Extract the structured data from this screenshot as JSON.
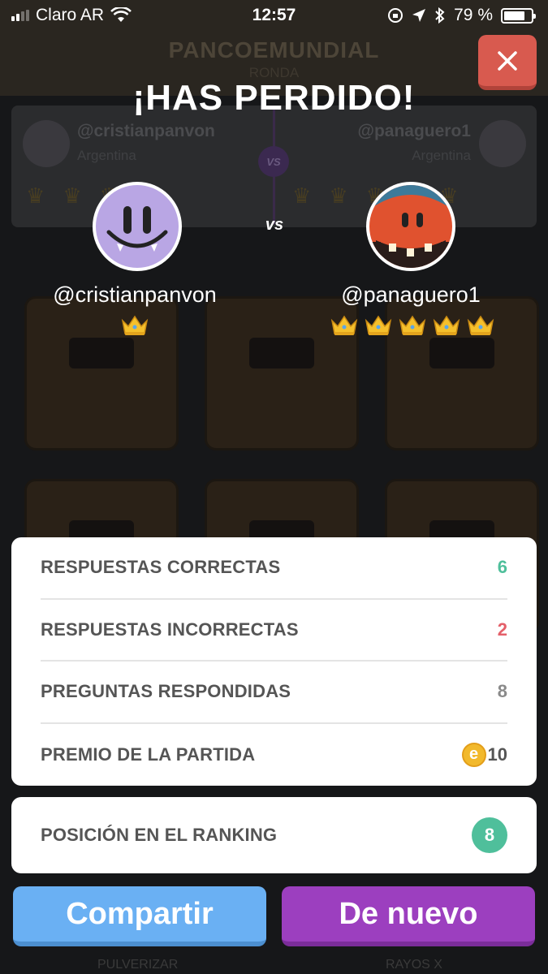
{
  "status_bar": {
    "carrier": "Claro AR",
    "time": "12:57",
    "battery": "79 %"
  },
  "background": {
    "game_title": "PANCOEMUNDIAL",
    "round_label": "RONDA",
    "left_name": "@cristianpanvon",
    "left_country": "Argentina",
    "vs": "VS",
    "right_name": "@panaguero1",
    "right_country": "Argentina",
    "bottom_left": "PULVERIZAR",
    "bottom_right": "RAYOS X"
  },
  "result": {
    "title": "¡HAS PERDIDO!"
  },
  "player_left": {
    "username": "@cristianpanvon",
    "crowns": 1
  },
  "vs_label": "vs",
  "player_right": {
    "username": "@panaguero1",
    "crowns": 5
  },
  "stats": {
    "correct": {
      "label": "RESPUESTAS CORRECTAS",
      "value": "6",
      "color": "#4fbf9b"
    },
    "incorrect": {
      "label": "RESPUESTAS INCORRECTAS",
      "value": "2",
      "color": "#e4606a"
    },
    "answered": {
      "label": "PREGUNTAS RESPONDIDAS",
      "value": "8",
      "color": "#8a8a8a"
    },
    "prize": {
      "label": "PREMIO DE LA PARTIDA",
      "coin_symbol": "e",
      "value": "10",
      "color": "#555555"
    }
  },
  "ranking": {
    "label": "POSICIÓN EN EL RANKING",
    "value": "8"
  },
  "buttons": {
    "share": "Compartir",
    "again": "De nuevo"
  },
  "icons": {
    "close": "close-icon",
    "crown": "crown-icon",
    "wifi": "wifi-icon",
    "battery": "battery-icon"
  }
}
